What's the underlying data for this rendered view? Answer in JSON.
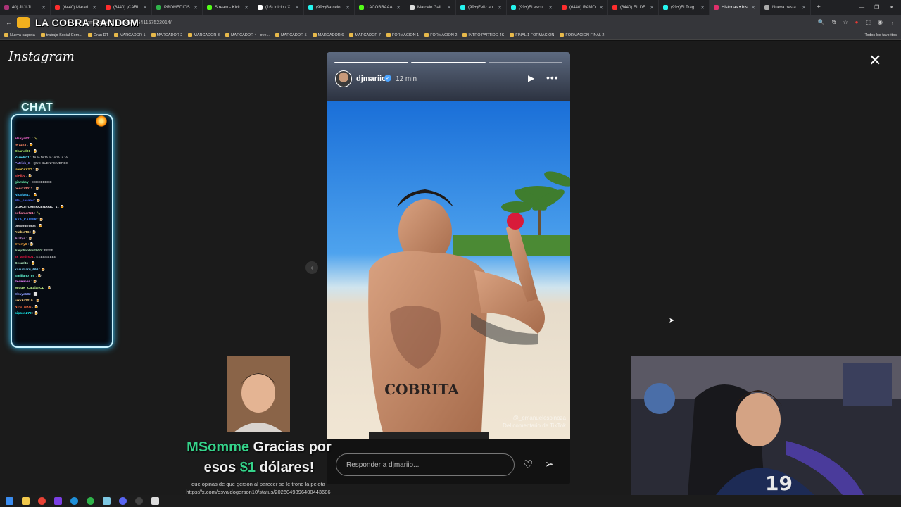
{
  "browser": {
    "tabs": [
      {
        "label": "40) Ji Ji Ji",
        "color": "#aa3377"
      },
      {
        "label": "(6440) Marad",
        "color": "#ff2d2d"
      },
      {
        "label": "(6440) ¡CARL",
        "color": "#ff2d2d"
      },
      {
        "label": "PROMEDIOS",
        "color": "#2fb34a"
      },
      {
        "label": "Stream - Kick",
        "color": "#53fc18"
      },
      {
        "label": "(16) Inicio / X",
        "color": "#ffffff"
      },
      {
        "label": "(99+)Barcelo",
        "color": "#25f4ee"
      },
      {
        "label": "LACOBRAAA",
        "color": "#53fc18"
      },
      {
        "label": "Marcelo Gall",
        "color": "#dddddd"
      },
      {
        "label": "(99+)Feliz an",
        "color": "#25f4ee"
      },
      {
        "label": "(99+)El escu",
        "color": "#25f4ee"
      },
      {
        "label": "(6440) RAMO",
        "color": "#ff2d2d"
      },
      {
        "label": "(6440) EL DE",
        "color": "#ff2d2d"
      },
      {
        "label": "(99+)El Trag",
        "color": "#25f4ee"
      },
      {
        "label": "Historias • Ins",
        "color": "#e1306c",
        "active": true
      },
      {
        "label": "Nueva pesta",
        "color": "#aaaaaa"
      }
    ],
    "url": "instagram.com/stories/djmariio/3825411575220​14/",
    "bookmarks": [
      "Nueva carpeta",
      "trabajo Social Com...",
      "Gran DT",
      "MARCADOR 1",
      "MARCADOR 2",
      "MARCADOR 3",
      "MARCADOR 4 - ove...",
      "MARCADOR 5",
      "MARCADOR 6",
      "MARCADOR 7",
      "FORMACION 1",
      "FORMACION 2",
      "INTRO PARTIDO 4K",
      "FINAL 1 FORMACION",
      "FORMACION FINAL 2"
    ],
    "bookmarks_all": "Todos los favoritos"
  },
  "overlay": {
    "brand": "LA COBRA RANDOM",
    "chat_title": "CHAT",
    "chat": [
      {
        "user": "elsayad21",
        "msg": "🍾",
        "color": "#ff6bd6"
      },
      {
        "user": "leraz23",
        "msg": "🍺",
        "color": "#ff8a65"
      },
      {
        "user": "Charud01",
        "msg": "🍺",
        "color": "#b3f56b"
      },
      {
        "user": "Yared011",
        "msg": "JAJAJAJAJAJAJAJAJA",
        "color": "#5ee7ff"
      },
      {
        "user": "Patrick_G",
        "msg": "QUE BUENAS UBRES",
        "color": "#9b8cff"
      },
      {
        "user": "IronCeX2D",
        "msg": "🍺",
        "color": "#ffd54f"
      },
      {
        "user": "ElPiby",
        "msg": "🍺",
        "color": "#ff5252"
      },
      {
        "user": "giamboy",
        "msg": "EEEEEEEEE",
        "color": "#69f0ae"
      },
      {
        "user": "benizz3012",
        "msg": "🍺",
        "color": "#ff8a80"
      },
      {
        "user": "Nicolas17",
        "msg": "🍺",
        "color": "#40c4ff"
      },
      {
        "user": "Mai_saaaav",
        "msg": "🍺",
        "color": "#536dfe"
      },
      {
        "user": "GORDITOMERCENARIO_1",
        "msg": "🍺",
        "color": "#ffffff"
      },
      {
        "user": "sofiamartz1",
        "msg": "🍾",
        "color": "#ff80ab"
      },
      {
        "user": "AXA_KAISER",
        "msg": "🍺",
        "color": "#448aff"
      },
      {
        "user": "bryongrrmos",
        "msg": "🍺",
        "color": "#e0e0e0"
      },
      {
        "user": "AfabioT6",
        "msg": "🍺",
        "color": "#ffe082"
      },
      {
        "user": "Arahjs",
        "msg": "🍺",
        "color": "#ce93d8"
      },
      {
        "user": "Everty9",
        "msg": "🍺",
        "color": "#ffab40"
      },
      {
        "user": "Alejo5antos2900",
        "msg": "EEEE",
        "color": "#a5d6a7"
      },
      {
        "user": "ss_andrs01",
        "msg": "EEEEEEEEE",
        "color": "#ff1744"
      },
      {
        "user": "Cesarito",
        "msg": "🍺",
        "color": "#b9f6ca"
      },
      {
        "user": "kasumaru_666",
        "msg": "🍺",
        "color": "#80d8ff"
      },
      {
        "user": "Emiliano_ml",
        "msg": "🍺",
        "color": "#64ffda"
      },
      {
        "user": "Fedelevis",
        "msg": "🍺",
        "color": "#ea80fc"
      },
      {
        "user": "Miguel_CatalanCD",
        "msg": "🍺",
        "color": "#ccff90"
      },
      {
        "user": "Elrayo182",
        "msg": "⬜",
        "color": "#8c9eff"
      },
      {
        "user": "jukkka2010",
        "msg": "🍺",
        "color": "#ffd180"
      },
      {
        "user": "NTG_ARG",
        "msg": "🍺",
        "color": "#ff6e40"
      },
      {
        "user": "pipoo1279",
        "msg": "🍺",
        "color": "#18ffff"
      }
    ],
    "donation": {
      "user": "MSomme",
      "text1": "Gracias por",
      "text2a": "esos ",
      "amount": "$1",
      "text2b": " dólares!",
      "message": "que opinas de que gerson al parecer se le trono la pelota",
      "link": "https://x.com/osvaldogerson10/status/2026049396400443686"
    }
  },
  "instagram": {
    "logo": "Instagram",
    "story": {
      "username": "djmariio",
      "time": "12 min",
      "progress_done": 2,
      "progress_total": 3,
      "credit_line1": "@_emanuelespinoza",
      "credit_line2": "Del comentario de TikTok",
      "tattoo_text": "COBRITA",
      "reply_placeholder": "Responder a djmariio..."
    },
    "icons": {
      "close": "close-icon",
      "prev": "chevron-left-icon",
      "play": "play-icon",
      "more": "more-icon",
      "like": "heart-icon",
      "send": "send-icon",
      "verified": "verified-badge-icon"
    }
  }
}
